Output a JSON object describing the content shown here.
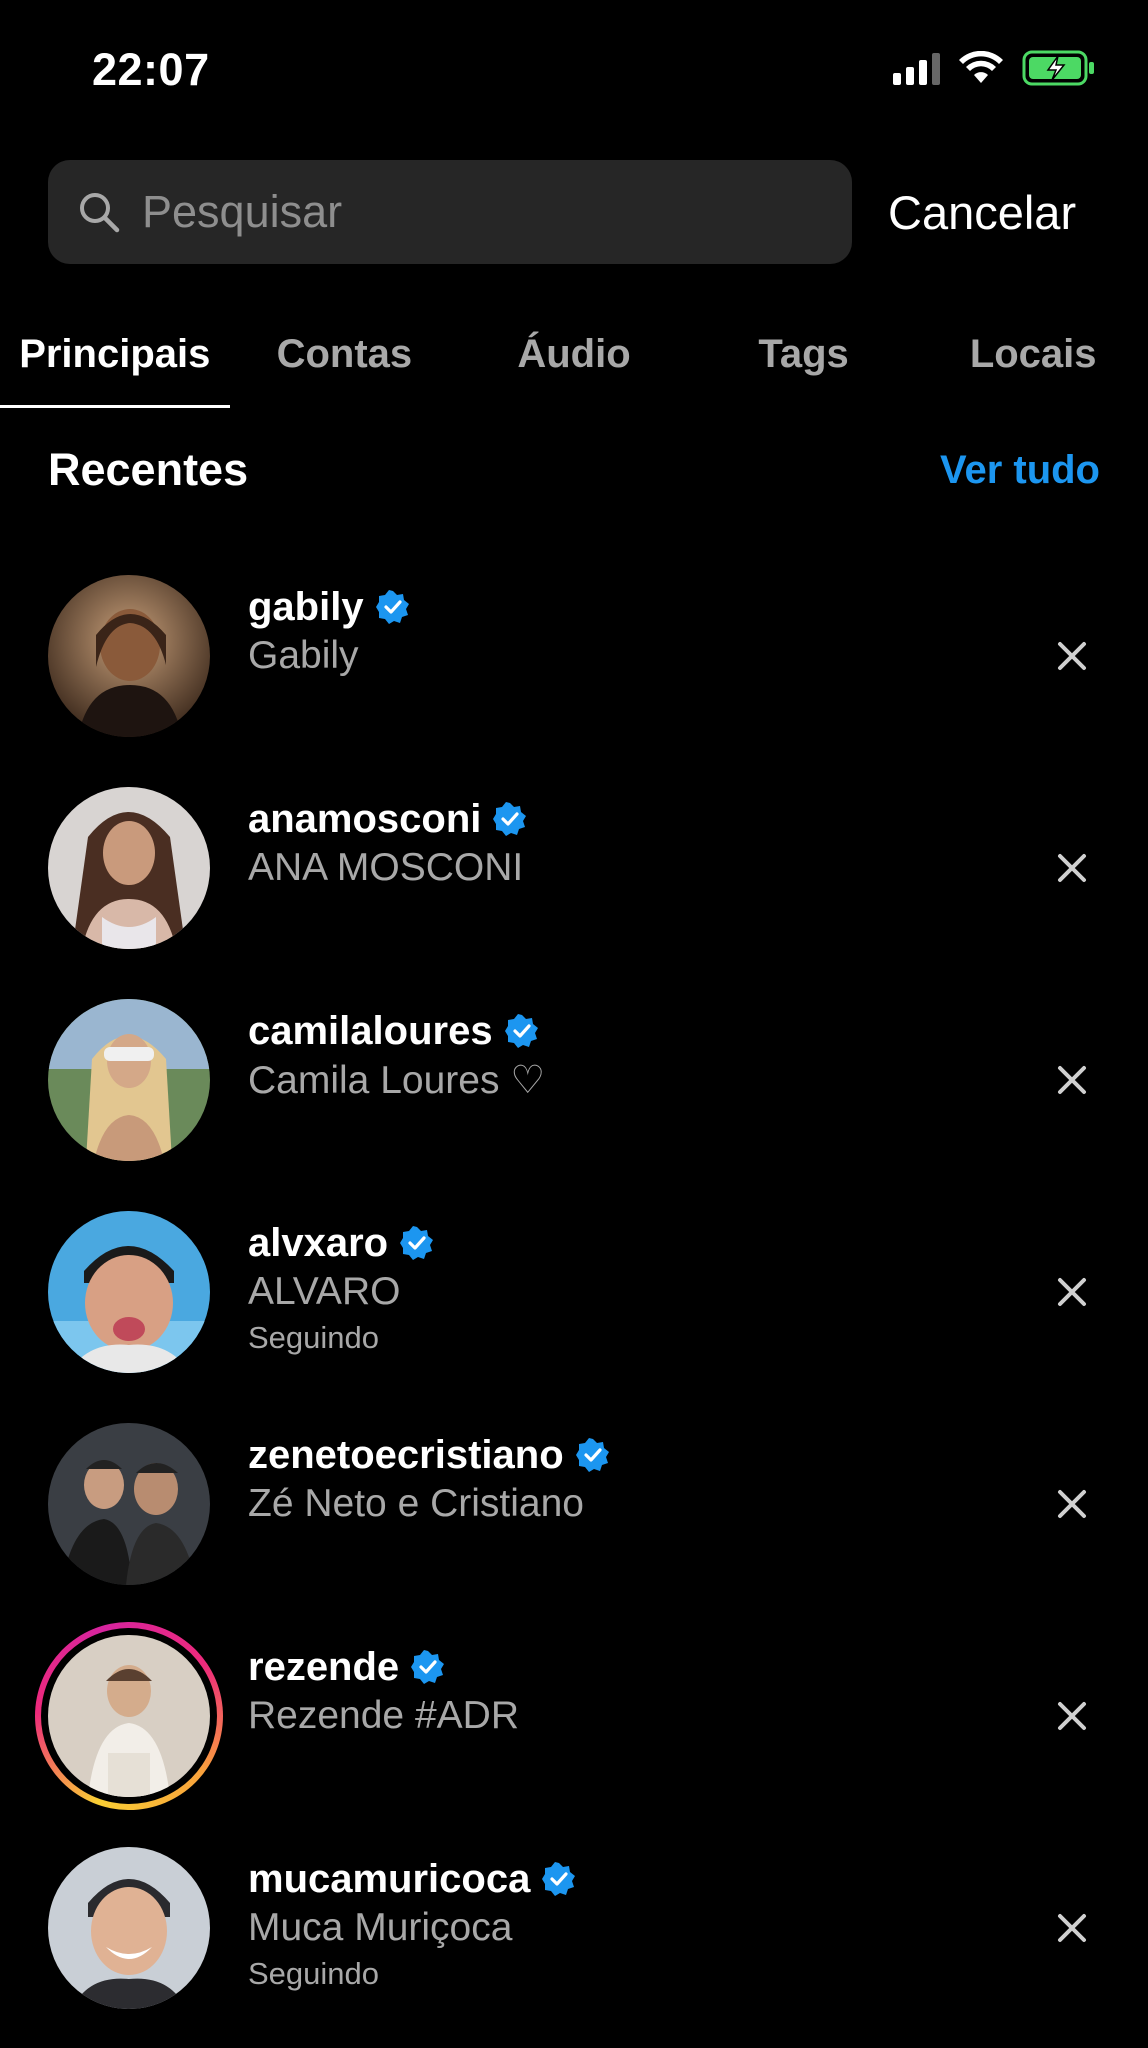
{
  "status_bar": {
    "time": "22:07",
    "icons": [
      "cellular-signal-icon",
      "wifi-icon",
      "battery-charging-icon"
    ]
  },
  "search": {
    "placeholder": "Pesquisar",
    "value": "",
    "cancel_label": "Cancelar"
  },
  "tabs": [
    {
      "label": "Principais",
      "active": true
    },
    {
      "label": "Contas",
      "active": false
    },
    {
      "label": "Áudio",
      "active": false
    },
    {
      "label": "Tags",
      "active": false
    },
    {
      "label": "Locais",
      "active": false
    }
  ],
  "recents": {
    "title": "Recentes",
    "see_all_label": "Ver tudo",
    "items": [
      {
        "username": "gabily",
        "name": "Gabily",
        "verified": true,
        "status": "",
        "story_ring": false
      },
      {
        "username": "anamosconi",
        "name": "ANA MOSCONI",
        "verified": true,
        "status": "",
        "story_ring": false
      },
      {
        "username": "camilaloures",
        "name": "Camila Loures ♡",
        "verified": true,
        "status": "",
        "story_ring": false
      },
      {
        "username": "alvxaro",
        "name": "ALVARO",
        "verified": true,
        "status": "Seguindo",
        "story_ring": false
      },
      {
        "username": "zenetoecristiano",
        "name": "Zé Neto e Cristiano",
        "verified": true,
        "status": "",
        "story_ring": false
      },
      {
        "username": "rezende",
        "name": "Rezende #ADR",
        "verified": true,
        "status": "",
        "story_ring": true
      },
      {
        "username": "mucamuricoca",
        "name": "Muca Muriçoca",
        "verified": true,
        "status": "Seguindo",
        "story_ring": false
      }
    ]
  },
  "colors": {
    "background": "#000000",
    "search_bg": "#262626",
    "secondary_text": "#a8a8a8",
    "accent_link": "#1c96f0",
    "verified_badge": "#1c96f0",
    "battery_green": "#4cd964"
  }
}
